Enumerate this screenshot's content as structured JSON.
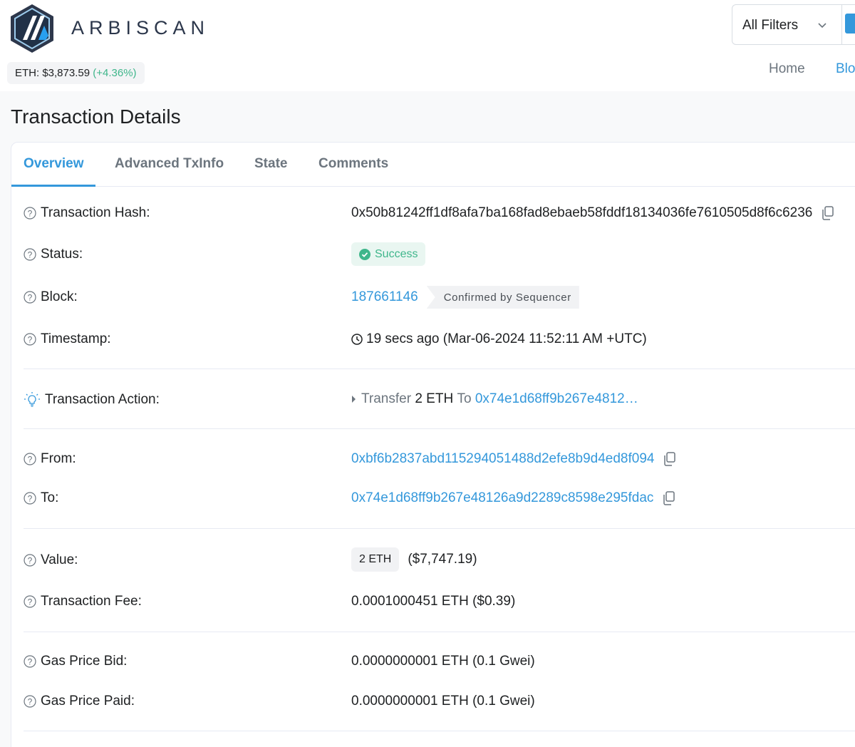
{
  "brand": {
    "name": "ARBISCAN"
  },
  "price": {
    "label": "ETH: $3,873.59",
    "change": "(+4.36%)"
  },
  "search": {
    "filter_label": "All Filters"
  },
  "nav": {
    "home": "Home",
    "blocks": "Blo"
  },
  "page": {
    "title": "Transaction Details"
  },
  "tabs": [
    {
      "label": "Overview",
      "active": true
    },
    {
      "label": "Advanced TxInfo",
      "active": false
    },
    {
      "label": "State",
      "active": false
    },
    {
      "label": "Comments",
      "active": false
    }
  ],
  "details": {
    "hash": {
      "label": "Transaction Hash:",
      "value": "0x50b81242ff1df8afa7ba168fad8ebaeb58fddf18134036fe7610505d8f6c6236"
    },
    "status": {
      "label": "Status:",
      "value": "Success"
    },
    "block": {
      "label": "Block:",
      "value": "187661146",
      "note": "Confirmed by Sequencer"
    },
    "timestamp": {
      "label": "Timestamp:",
      "value": "19 secs ago (Mar-06-2024 11:52:11 AM +UTC)"
    },
    "action": {
      "label": "Transaction Action:",
      "verb": "Transfer",
      "amount": "2 ETH",
      "to_word": "To",
      "to_address": "0x74e1d68ff9b267e4812…"
    },
    "from": {
      "label": "From:",
      "value": "0xbf6b2837abd115294051488d2efe8b9d4ed8f094"
    },
    "to": {
      "label": "To:",
      "value": "0x74e1d68ff9b267e48126a9d2289c8598e295fdac"
    },
    "value": {
      "label": "Value:",
      "amount": "2 ETH",
      "usd": "($7,747.19)"
    },
    "fee": {
      "label": "Transaction Fee:",
      "value": "0.0001000451 ETH ($0.39)"
    },
    "gas_bid": {
      "label": "Gas Price Bid:",
      "value": "0.0000000001 ETH (0.1 Gwei)"
    },
    "gas_paid": {
      "label": "Gas Price Paid:",
      "value": "0.0000000001 ETH (0.1 Gwei)"
    }
  },
  "colors": {
    "accent": "#3498db",
    "success": "#3fb68b",
    "text": "#1e2022",
    "muted": "#6c757e"
  }
}
